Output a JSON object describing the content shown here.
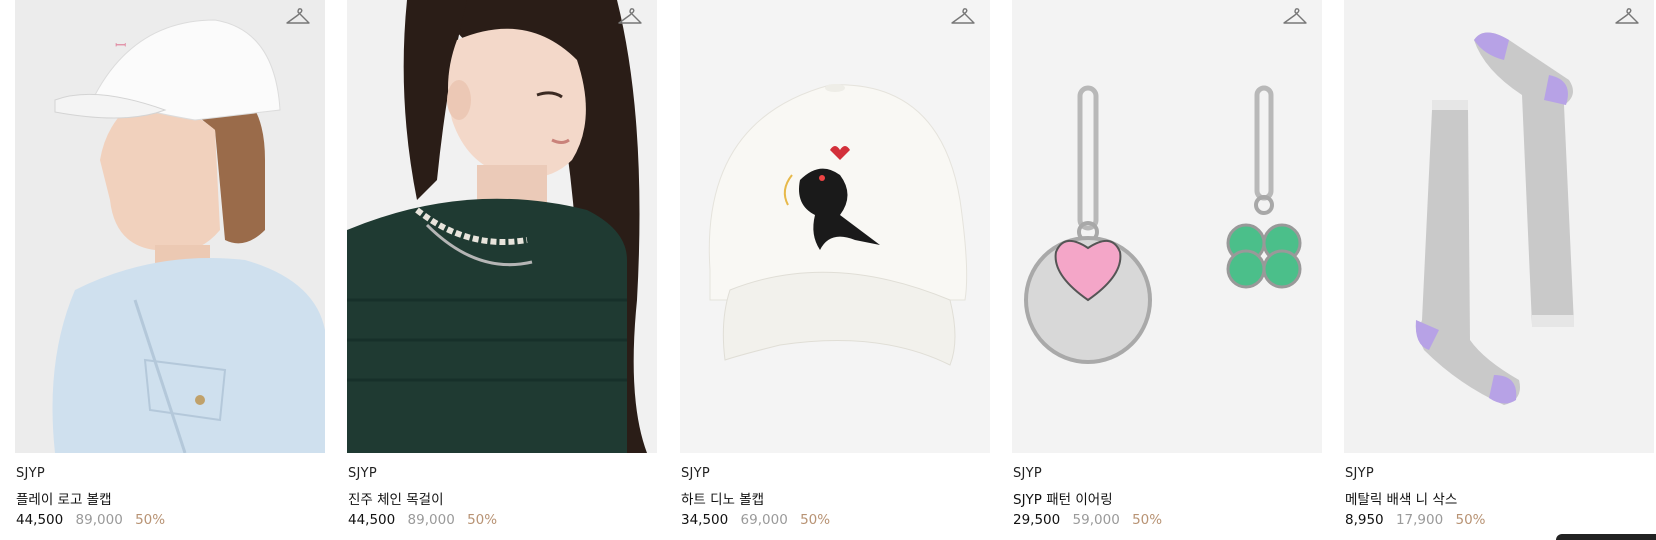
{
  "products": [
    {
      "brand": "SJYP",
      "name": "플레이 로고 볼캡",
      "price": "44,500",
      "original_price": "89,000",
      "discount": "50%",
      "image": "model-wearing-white-logo-cap"
    },
    {
      "brand": "SJYP",
      "name": "진주 체인 목걸이",
      "price": "44,500",
      "original_price": "89,000",
      "discount": "50%",
      "image": "model-wearing-pearl-chain-necklace"
    },
    {
      "brand": "SJYP",
      "name": "하트 디노 볼캡",
      "price": "34,500",
      "original_price": "69,000",
      "discount": "50%",
      "image": "white-cap-with-dino-embroidery"
    },
    {
      "brand": "SJYP",
      "name": "SJYP 패턴 이어링",
      "price": "29,500",
      "original_price": "59,000",
      "discount": "50%",
      "image": "heart-and-clover-earrings"
    },
    {
      "brand": "SJYP",
      "name": "메탈릭 배색 니 삭스",
      "price": "8,950",
      "original_price": "17,900",
      "discount": "50%",
      "image": "grey-lilac-knee-socks"
    }
  ],
  "icons": {
    "wishlist": "hanger-icon"
  },
  "colors": {
    "discount": "#b89374",
    "original_price": "#9a9a9a",
    "text": "#111111"
  }
}
